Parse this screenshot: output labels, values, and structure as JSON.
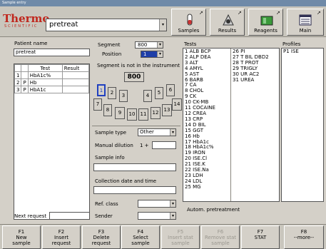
{
  "window_title": "Sample entry",
  "logo": {
    "main": "Thermo",
    "sub": "SCIENTIFIC"
  },
  "test_selector": {
    "value": "pretreat"
  },
  "nav": [
    {
      "label": "Samples",
      "icon": "tube-icon"
    },
    {
      "label": "Results",
      "icon": "results-icon"
    },
    {
      "label": "Reagents",
      "icon": "reagents-icon"
    },
    {
      "label": "Main",
      "icon": "main-menu-icon"
    }
  ],
  "patient": {
    "name_label": "Patient name",
    "name_value": "pretreat",
    "table_headers": [
      "",
      "",
      "Test",
      "Result"
    ],
    "rows": [
      {
        "no": "1",
        "flag": "",
        "test": "HbA1c%",
        "result": ""
      },
      {
        "no": "2",
        "flag": "P",
        "test": "Hb",
        "result": ""
      },
      {
        "no": "3",
        "flag": "P",
        "test": "HbA1c",
        "result": ""
      }
    ],
    "next_request_label": "Next request",
    "next_request_value": ""
  },
  "segment": {
    "segment_label": "Segment",
    "segment_value": "800",
    "position_label": "Position",
    "position_value": "1",
    "notice": "Segment is not in the instrument",
    "segment_display": "800",
    "positions": [
      "1",
      "2",
      "3",
      "4",
      "5",
      "6",
      "7",
      "8",
      "9",
      "10",
      "11",
      "12",
      "13",
      "14"
    ]
  },
  "sample": {
    "type_label": "Sample type",
    "type_value": "Other",
    "dilution_label": "Manual dilution",
    "dilution_prefix": "1 +",
    "dilution_value": "",
    "info_label": "Sample info",
    "info_value": "",
    "collection_label": "Collection date and time",
    "collection_value": "",
    "ref_class_label": "Ref. class",
    "ref_class_value": "",
    "sender_label": "Sender",
    "sender_value": ""
  },
  "tests": {
    "label": "Tests",
    "col1": [
      "1 ALB BCP",
      "2 ALP DEA",
      "3 ALT",
      "4 AMYL",
      "5 AST",
      "6 BARB",
      "7 CA",
      "8 CHOL",
      "9 CK",
      "10 CK-MB",
      "11 COCAINE",
      "12 CREA",
      "13 CRP",
      "14 D BIL",
      "15 GGT",
      "16 Hb",
      "17 HbA1c",
      "18 HbA1c%",
      "19 IRON",
      "20 ISE.Cl",
      "21 ISE.K",
      "22 ISE.Na",
      "23 LDH",
      "24 LDL",
      "25 MG"
    ],
    "col2": [
      "26 PI",
      "27 T BIL DBD2",
      "28 T PROT",
      "29 TRIGLY",
      "30 UR AC2",
      "31 UREA"
    ]
  },
  "profiles": {
    "label": "Profiles",
    "items": [
      "P1 ISE"
    ]
  },
  "autom_pretreatment": "Autom. pretreatment",
  "fkeys": [
    {
      "key": "F1",
      "label1": "New",
      "label2": "sample",
      "enabled": true
    },
    {
      "key": "F2",
      "label1": "Insert",
      "label2": "request",
      "enabled": true
    },
    {
      "key": "F3",
      "label1": "Delete",
      "label2": "request",
      "enabled": true
    },
    {
      "key": "F4",
      "label1": "Select",
      "label2": "sample",
      "enabled": true
    },
    {
      "key": "F5",
      "label1": "Insert stat",
      "label2": "sample",
      "enabled": false
    },
    {
      "key": "F6",
      "label1": "Remove stat",
      "label2": "sample",
      "enabled": false
    },
    {
      "key": "F7",
      "label1": "STAT",
      "label2": "",
      "enabled": true
    },
    {
      "key": "F8",
      "label1": "--more--",
      "label2": "",
      "enabled": true
    }
  ]
}
